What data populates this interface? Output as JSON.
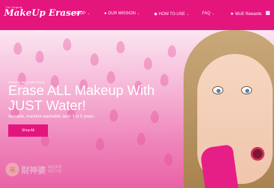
{
  "nav": {
    "logo_top": "The Original",
    "logo": "MakeUp Eraser",
    "items": [
      {
        "label": "SHOP",
        "icon": "none",
        "chevron": "⌄"
      },
      {
        "label": "OUR MISSION",
        "icon": "globe-icon",
        "chevron": "⌄"
      },
      {
        "label": "HOW TO USE",
        "icon": "lips-icon",
        "chevron": "⌄"
      },
      {
        "label": "FAQ",
        "icon": "none",
        "chevron": "⌄"
      },
      {
        "label": "MUE Rewards",
        "icon": "star-icon",
        "chevron": ""
      }
    ],
    "accent": "#e5157e"
  },
  "hero": {
    "kicker": "OVER 5 MILLION SOLD",
    "headline": "Erase ALL Makeup With JUST Water!",
    "subtext": "reusable, machine washable, lasts 3 to 5 years.",
    "button_label": "Shop All"
  },
  "watermark": {
    "text": "财神婆",
    "sub1": "精品资源",
    "sub2": "快乐分享"
  }
}
